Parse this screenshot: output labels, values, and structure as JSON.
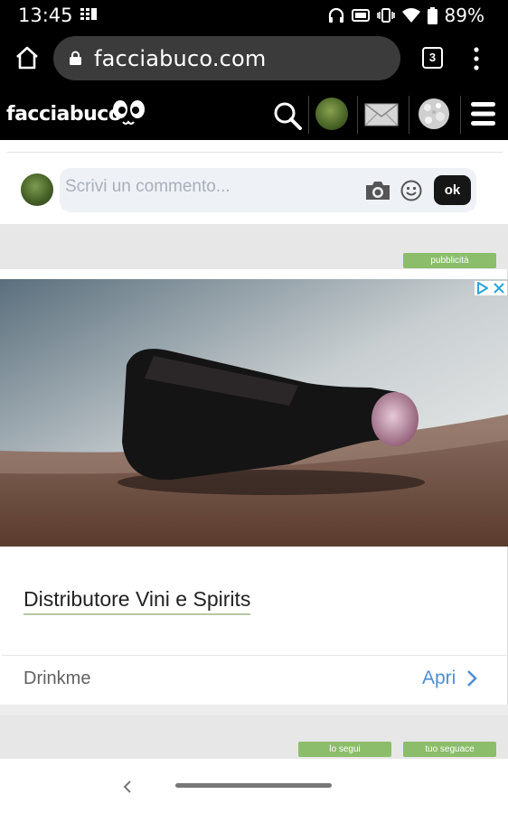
{
  "status_bar": {
    "time": "13:45",
    "battery": "89%",
    "icons": [
      "grid-icon",
      "headphones-icon",
      "tv-icon",
      "vibrate-icon",
      "wifi-icon",
      "battery-icon"
    ]
  },
  "browser": {
    "url": "facciabuco.com",
    "tab_count": "3"
  },
  "site_header": {
    "logo_text": "facciabuco",
    "icons": [
      "logo-eyes-icon",
      "search-icon",
      "avatar",
      "mail-icon",
      "globe-icon",
      "hamburger-menu-icon"
    ]
  },
  "comment": {
    "placeholder": "Scrivi un commento...",
    "submit_label": "ok"
  },
  "ad": {
    "badge": "pubblicità",
    "title": "Distributore Vini e Spirits",
    "advertiser": "Drinkme",
    "cta": "Apri"
  },
  "follow": {
    "following_label": "lo segui",
    "follower_label": "tuo seguace"
  },
  "colors": {
    "accent_green": "#8bbd6a",
    "link_blue": "#4f8fd6",
    "header_bg": "#000000"
  }
}
